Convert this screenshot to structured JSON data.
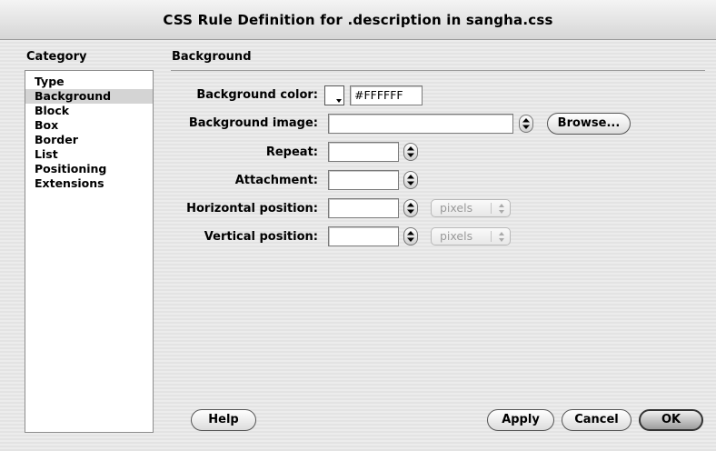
{
  "window": {
    "title": "CSS Rule Definition for .description in sangha.css"
  },
  "category": {
    "heading": "Category",
    "items": [
      {
        "label": "Type",
        "selected": false
      },
      {
        "label": "Background",
        "selected": true
      },
      {
        "label": "Block",
        "selected": false
      },
      {
        "label": "Box",
        "selected": false
      },
      {
        "label": "Border",
        "selected": false
      },
      {
        "label": "List",
        "selected": false
      },
      {
        "label": "Positioning",
        "selected": false
      },
      {
        "label": "Extensions",
        "selected": false
      }
    ]
  },
  "panel": {
    "heading": "Background",
    "background_color_label": "Background color:",
    "background_color_value": "#FFFFFF",
    "swatch_color": "#FFFFFF",
    "background_image_label": "Background image:",
    "background_image_value": "",
    "browse_label": "Browse...",
    "repeat_label": "Repeat:",
    "repeat_value": "",
    "attachment_label": "Attachment:",
    "attachment_value": "",
    "horizontal_position_label": "Horizontal position:",
    "horizontal_position_value": "",
    "horizontal_unit": "pixels",
    "vertical_position_label": "Vertical position:",
    "vertical_position_value": "",
    "vertical_unit": "pixels"
  },
  "buttons": {
    "help": "Help",
    "apply": "Apply",
    "cancel": "Cancel",
    "ok": "OK"
  }
}
